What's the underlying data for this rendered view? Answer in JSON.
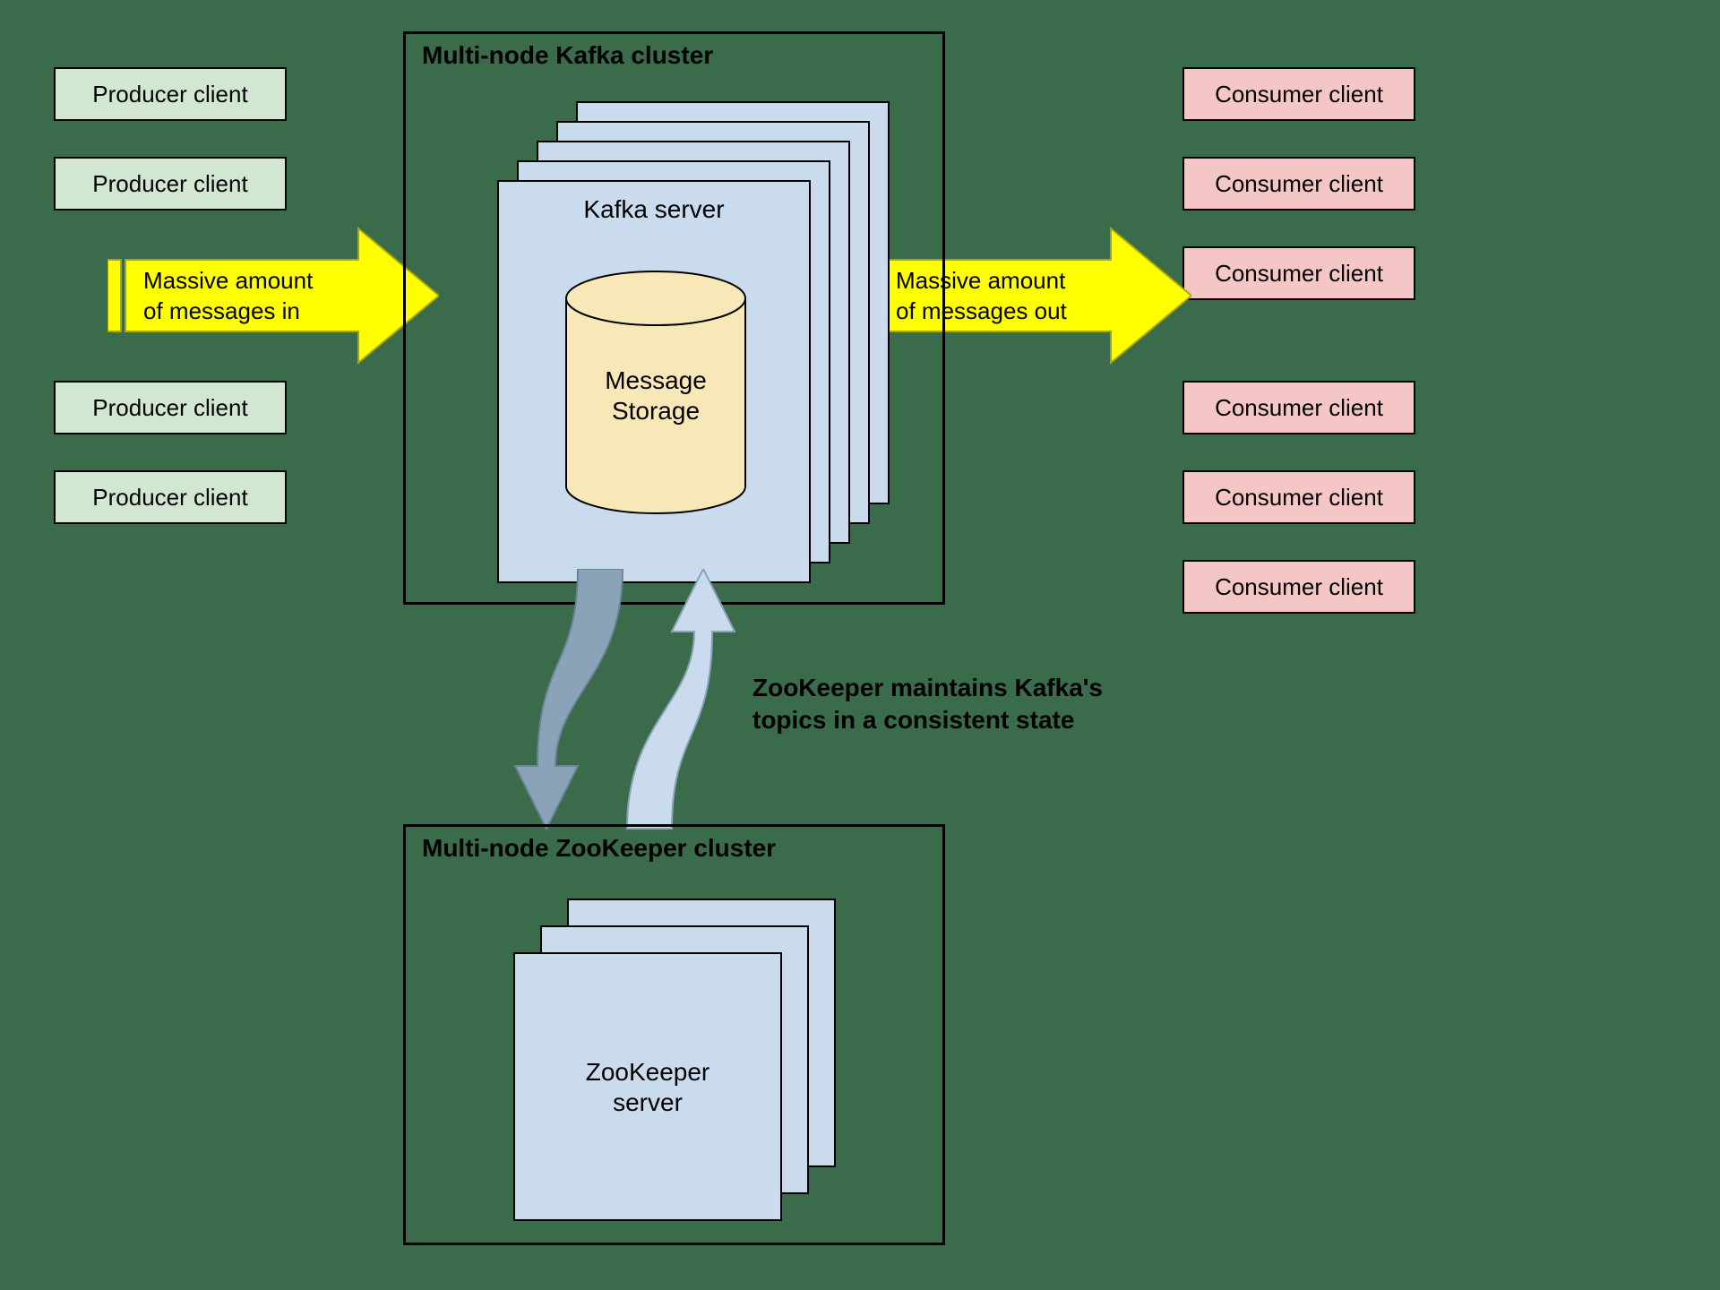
{
  "producers": [
    "Producer client",
    "Producer client",
    "Producer client",
    "Producer client"
  ],
  "consumers": [
    "Consumer client",
    "Consumer client",
    "Consumer client",
    "Consumer client",
    "Consumer client",
    "Consumer client"
  ],
  "arrows": {
    "in_line1": "Massive amount",
    "in_line2": "of messages in",
    "out_line1": "Massive amount",
    "out_line2": "of messages out"
  },
  "kafka_cluster": {
    "title": "Multi-node Kafka cluster",
    "server_label": "Kafka server",
    "storage_line1": "Message",
    "storage_line2": "Storage"
  },
  "zk_cluster": {
    "title": "Multi-node ZooKeeper cluster",
    "server_line1": "ZooKeeper",
    "server_line2": "server"
  },
  "zk_annotation_line1": "ZooKeeper maintains Kafka's",
  "zk_annotation_line2": "topics in a consistent state"
}
